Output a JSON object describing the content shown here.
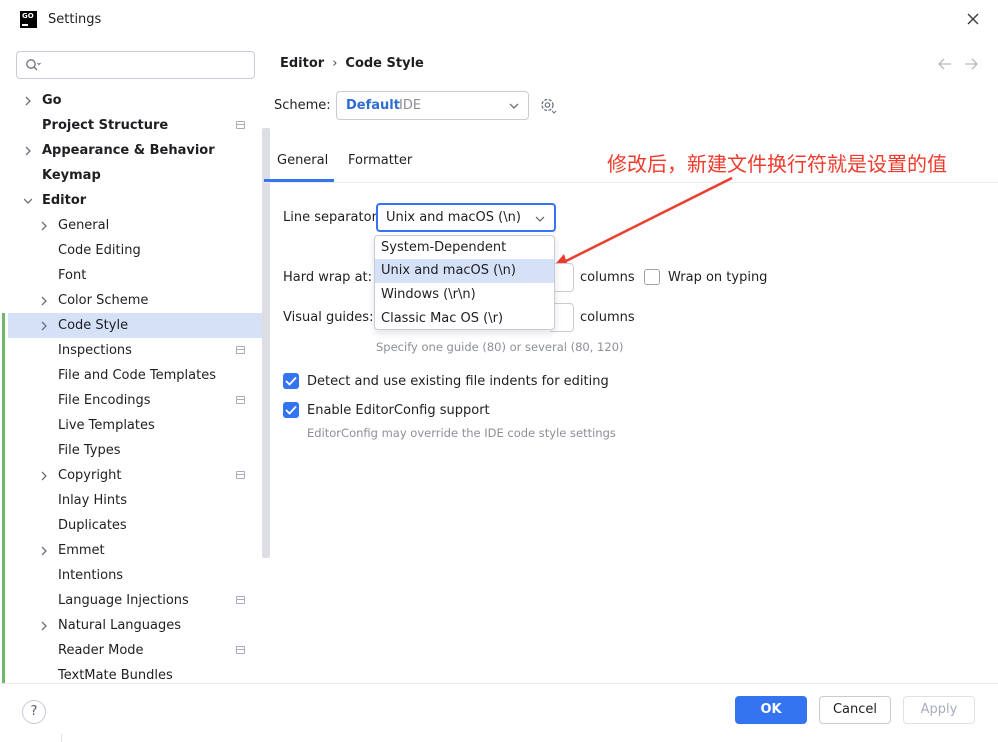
{
  "window": {
    "title": "Settings",
    "logo_text": "GO"
  },
  "search": {
    "placeholder": ""
  },
  "sidebar": {
    "items": [
      {
        "label": "Go",
        "level": 0,
        "bold": true,
        "chevron": true,
        "proj": false
      },
      {
        "label": "Project Structure",
        "level": 0,
        "bold": true,
        "chevron": false,
        "proj": true
      },
      {
        "label": "Appearance & Behavior",
        "level": 0,
        "bold": true,
        "chevron": true,
        "proj": false
      },
      {
        "label": "Keymap",
        "level": 0,
        "bold": true,
        "chevron": false,
        "proj": false
      },
      {
        "label": "Editor",
        "level": 0,
        "bold": true,
        "chevron": "down",
        "proj": false
      },
      {
        "label": "General",
        "level": 1,
        "bold": false,
        "chevron": true,
        "proj": false
      },
      {
        "label": "Code Editing",
        "level": 1,
        "bold": false,
        "chevron": false,
        "proj": false
      },
      {
        "label": "Font",
        "level": 1,
        "bold": false,
        "chevron": false,
        "proj": false
      },
      {
        "label": "Color Scheme",
        "level": 1,
        "bold": false,
        "chevron": true,
        "proj": false
      },
      {
        "label": "Code Style",
        "level": 1,
        "bold": false,
        "chevron": true,
        "proj": false,
        "selected": true
      },
      {
        "label": "Inspections",
        "level": 1,
        "bold": false,
        "chevron": false,
        "proj": true
      },
      {
        "label": "File and Code Templates",
        "level": 1,
        "bold": false,
        "chevron": false,
        "proj": false
      },
      {
        "label": "File Encodings",
        "level": 1,
        "bold": false,
        "chevron": false,
        "proj": true
      },
      {
        "label": "Live Templates",
        "level": 1,
        "bold": false,
        "chevron": false,
        "proj": false
      },
      {
        "label": "File Types",
        "level": 1,
        "bold": false,
        "chevron": false,
        "proj": false
      },
      {
        "label": "Copyright",
        "level": 1,
        "bold": false,
        "chevron": true,
        "proj": true
      },
      {
        "label": "Inlay Hints",
        "level": 1,
        "bold": false,
        "chevron": false,
        "proj": false
      },
      {
        "label": "Duplicates",
        "level": 1,
        "bold": false,
        "chevron": false,
        "proj": false
      },
      {
        "label": "Emmet",
        "level": 1,
        "bold": false,
        "chevron": true,
        "proj": false
      },
      {
        "label": "Intentions",
        "level": 1,
        "bold": false,
        "chevron": false,
        "proj": false
      },
      {
        "label": "Language Injections",
        "level": 1,
        "bold": false,
        "chevron": false,
        "proj": true
      },
      {
        "label": "Natural Languages",
        "level": 1,
        "bold": false,
        "chevron": true,
        "proj": false
      },
      {
        "label": "Reader Mode",
        "level": 1,
        "bold": false,
        "chevron": false,
        "proj": true
      },
      {
        "label": "TextMate Bundles",
        "level": 1,
        "bold": false,
        "chevron": false,
        "proj": false
      }
    ]
  },
  "breadcrumb": {
    "parent": "Editor",
    "separator": "›",
    "current": "Code Style"
  },
  "scheme": {
    "label": "Scheme:",
    "value": "Default",
    "sub": "IDE"
  },
  "tabs": {
    "general": "General",
    "formatter": "Formatter"
  },
  "annotation": {
    "text": "修改后，新建文件换行符就是设置的值",
    "color": "#ef3b2c"
  },
  "form": {
    "line_separator_label": "Line separator:",
    "line_separator_value": "Unix and macOS (\\n)",
    "line_separator_options": [
      "System-Dependent",
      "Unix and macOS (\\n)",
      "Windows (\\r\\n)",
      "Classic Mac OS (\\r)"
    ],
    "hard_wrap_label": "Hard wrap at:",
    "columns_label": "columns",
    "wrap_on_typing_label": "Wrap on typing",
    "wrap_on_typing_checked": false,
    "visual_guides_label": "Visual guides:",
    "visual_guides_columns_label": "columns",
    "visual_guides_hint": "Specify one guide (80) or several (80, 120)",
    "detect_indents_label": "Detect and use existing file indents for editing",
    "detect_indents_checked": true,
    "editorconfig_label": "Enable EditorConfig support",
    "editorconfig_checked": true,
    "editorconfig_hint": "EditorConfig may override the IDE code style settings"
  },
  "footer": {
    "help": "?",
    "ok": "OK",
    "cancel": "Cancel",
    "apply": "Apply"
  },
  "colors": {
    "accent": "#3574f0",
    "selection": "#d5e1f6",
    "scheme_value": "#2f6dd0"
  }
}
